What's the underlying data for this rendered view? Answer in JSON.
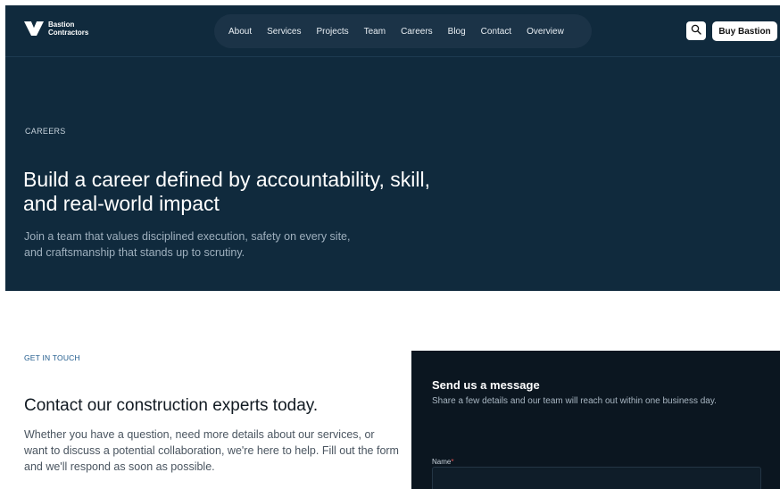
{
  "brand": {
    "line1": "Bastion",
    "line2": "Contractors",
    "logo_icon": "bastion-logo-mark"
  },
  "nav": {
    "links": [
      "About",
      "Services",
      "Projects",
      "Team",
      "Careers",
      "Blog",
      "Contact",
      "Overview"
    ],
    "search_icon": "search-icon",
    "buy_label": "Buy Bastion"
  },
  "hero": {
    "eyebrow": "CAREERS",
    "title": "Build a career defined by accountability, skill, and real-world impact",
    "subtitle": "Join a team that values disciplined execution, safety on every site, and craftsmanship that stands up to scrutiny."
  },
  "contact": {
    "eyebrow": "GET IN TOUCH",
    "title": "Contact our construction experts today.",
    "text": "Whether you have a question, need more details about our services, or want to discuss a potential collaboration, we're here to help. Fill out the form and we'll respond as soon as possible."
  },
  "form": {
    "title": "Send us a message",
    "subtitle": "Share a few details and our team will reach out within one business day.",
    "name_label": "Name",
    "required_mark": "*",
    "name_value": ""
  },
  "colors": {
    "hero_bg": "#102a3d",
    "nav_pill_bg": "#1b3347",
    "form_bg": "#0b1620",
    "accent_blue": "#1f5a8c",
    "required_red": "#e05252"
  }
}
